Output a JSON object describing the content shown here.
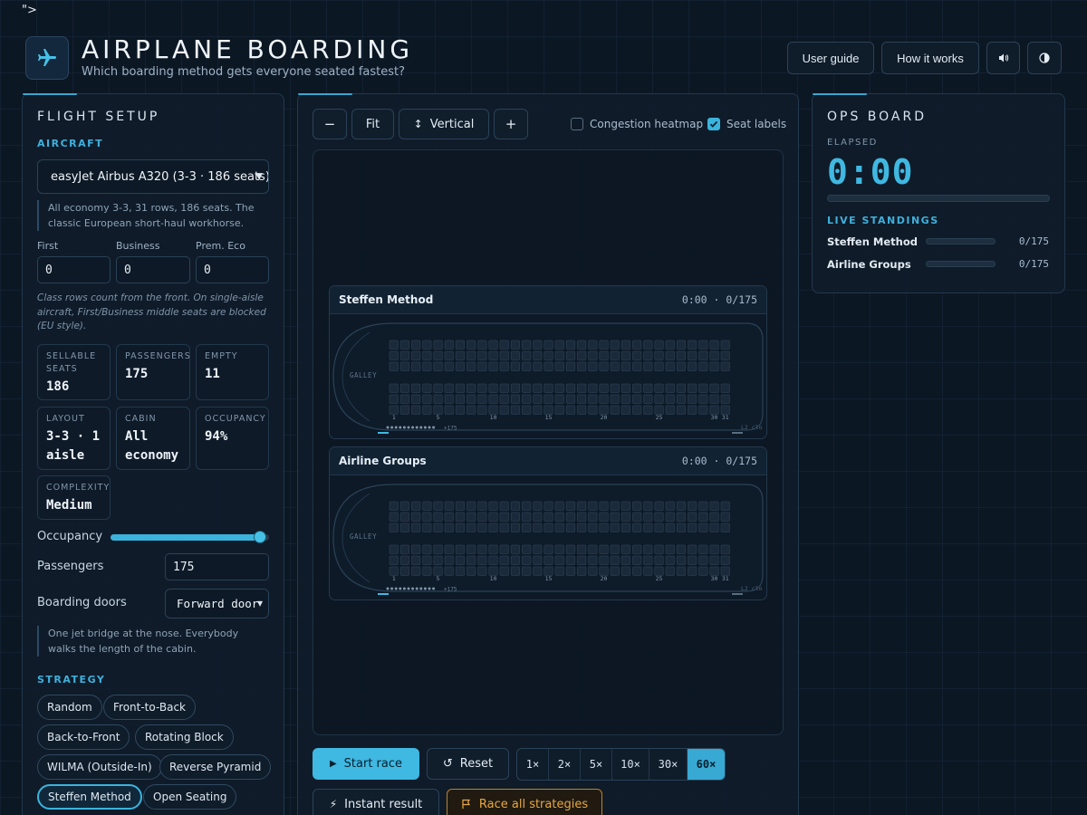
{
  "stray_text": "\">",
  "header": {
    "title": "AIRPLANE BOARDING",
    "subtitle": "Which boarding method gets everyone seated fastest?",
    "user_guide": "User guide",
    "how_it_works": "How it works"
  },
  "setup": {
    "title": "FLIGHT SETUP",
    "aircraft_section": "AIRCRAFT",
    "aircraft_value": "easyJet Airbus A320 (3-3 · 186 seats)",
    "aircraft_note": "All economy 3-3, 31 rows, 186 seats. The classic European short-haul workhorse.",
    "class_labels": [
      "First",
      "Business",
      "Prem. Eco"
    ],
    "class_values": [
      "0",
      "0",
      "0"
    ],
    "class_note": "Class rows count from the front. On single-aisle aircraft, First/Business middle seats are blocked (EU style).",
    "stats": [
      {
        "k": "SELLABLE SEATS",
        "v": "186"
      },
      {
        "k": "PASSENGERS",
        "v": "175"
      },
      {
        "k": "EMPTY",
        "v": "11"
      },
      {
        "k": "LAYOUT",
        "v": "3-3 · 1 aisle"
      },
      {
        "k": "CABIN",
        "v": "All economy"
      },
      {
        "k": "OCCUPANCY",
        "v": "94%"
      },
      {
        "k": "COMPLEXITY",
        "v": "Medium"
      }
    ],
    "occupancy_label": "Occupancy",
    "occupancy_fraction": 0.94,
    "passengers_label": "Passengers",
    "passengers_value": "175",
    "doors_label": "Boarding doors",
    "doors_value": "Forward door",
    "doors_note": "One jet bridge at the nose. Everybody walks the length of the cabin.",
    "strategy_section": "STRATEGY",
    "strategies": [
      "Random",
      "Front-to-Back",
      "Back-to-Front",
      "Rotating Block",
      "WILMA (Outside-In)",
      "Reverse Pyramid",
      "Steffen Method",
      "Open Seating"
    ],
    "active_strategy": "Steffen Method"
  },
  "toolbar": {
    "zoom_out": "−",
    "fit": "Fit",
    "orientation": "Vertical",
    "zoom_in": "+",
    "heatmap_label": "Congestion heatmap",
    "heatmap_checked": false,
    "seat_labels_label": "Seat labels",
    "seat_labels_checked": true
  },
  "planes": [
    {
      "name": "Steffen Method",
      "status": "0:00 · 0/175"
    },
    {
      "name": "Airline Groups",
      "status": "0:00 · 0/175"
    }
  ],
  "cabin": {
    "galley": "GALLEY",
    "row_ticks": [
      "1",
      "5",
      "10",
      "15",
      "20",
      "25",
      "30",
      "31"
    ],
    "queue_label": "+175",
    "rows": 31,
    "seats_per_side": 3,
    "l2": "L2 clo"
  },
  "controls": {
    "start": "Start race",
    "reset": "Reset",
    "speeds": [
      "1×",
      "2×",
      "5×",
      "10×",
      "30×",
      "60×"
    ],
    "active_speed": "60×",
    "instant": "Instant result",
    "race_all": "Race all strategies"
  },
  "ops": {
    "title": "OPS BOARD",
    "elapsed_label": "ELAPSED",
    "elapsed_value": "0:00",
    "elapsed_progress": 0,
    "standings_label": "LIVE STANDINGS",
    "standings": [
      {
        "name": "Steffen Method",
        "value": "0/175",
        "progress": 0
      },
      {
        "name": "Airline Groups",
        "value": "0/175",
        "progress": 0
      }
    ]
  }
}
